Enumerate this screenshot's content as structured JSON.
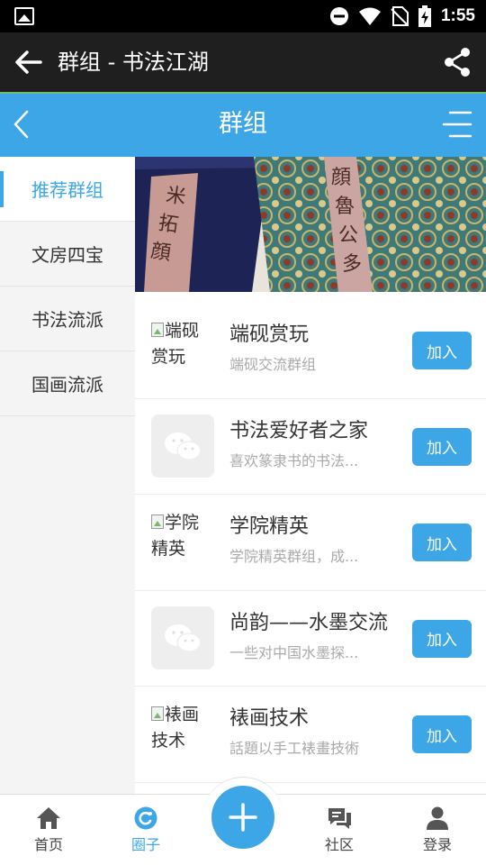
{
  "status_bar": {
    "time": "1:55",
    "icons": [
      "image-notification-icon",
      "do-not-disturb-icon",
      "wifi-icon",
      "no-sim-icon",
      "battery-charging-icon"
    ]
  },
  "app_bar": {
    "title": "群组 - 书法江湖",
    "back_icon": "arrow-left-icon",
    "share_icon": "share-icon"
  },
  "header": {
    "title": "群组",
    "back_icon": "chevron-left-icon",
    "menu_icon": "menu-icon",
    "color": "#3ca6e6"
  },
  "sidebar": {
    "items": [
      {
        "label": "推荐群组",
        "active": true
      },
      {
        "label": "文房四宝",
        "active": false
      },
      {
        "label": "书法流派",
        "active": false
      },
      {
        "label": "国画流派",
        "active": false
      }
    ]
  },
  "groups": [
    {
      "avatar_alt": "端砚赏玩",
      "avatar_type": "broken-image",
      "name": "端砚赏玩",
      "desc": "端砚交流群组",
      "join_label": "加入"
    },
    {
      "avatar_alt": "",
      "avatar_type": "wechat-placeholder",
      "name": "书法爱好者之家",
      "desc": "喜欢篆隶书的书法...",
      "join_label": "加入"
    },
    {
      "avatar_alt": "学院精英",
      "avatar_type": "broken-image",
      "name": "学院精英",
      "desc": "学院精英群组，成...",
      "join_label": "加入"
    },
    {
      "avatar_alt": "",
      "avatar_type": "wechat-placeholder",
      "name": "尚韵——水墨交流",
      "desc": "一些对中国水墨探...",
      "join_label": "加入"
    },
    {
      "avatar_alt": "裱画技术",
      "avatar_type": "broken-image",
      "name": "裱画技术",
      "desc": "話題以手工裱畫技術",
      "join_label": "加入"
    }
  ],
  "bottom_nav": {
    "items": [
      {
        "label": "首页",
        "icon": "home-icon",
        "active": false
      },
      {
        "label": "圈子",
        "icon": "circle-icon",
        "active": true
      },
      {
        "label": "社区",
        "icon": "community-icon",
        "active": false
      },
      {
        "label": "登录",
        "icon": "user-icon",
        "active": false
      }
    ],
    "fab_icon": "plus-icon"
  },
  "colors": {
    "accent": "#3ca6e6",
    "app_bar": "#1f1f1f",
    "sidebar_bg": "#f4f4f4"
  }
}
